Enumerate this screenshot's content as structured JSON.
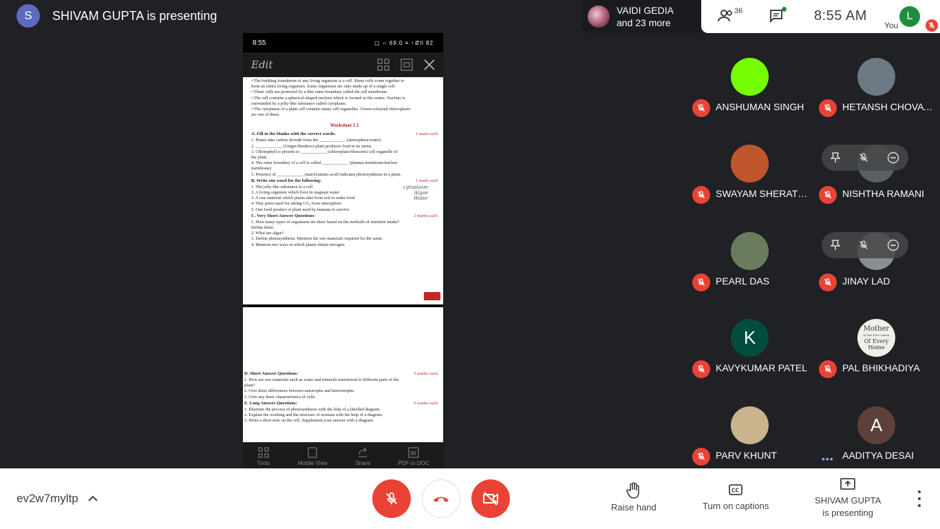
{
  "header": {
    "presenter_initial": "S",
    "presenter_text": "SHIVAM GUPTA is presenting"
  },
  "top_people": {
    "name": "VAIDI GEDIA",
    "more": "and 23 more"
  },
  "top_bar": {
    "people_count": "36",
    "time": "8:55  AM",
    "you_initial": "L",
    "you_label": "You"
  },
  "shared_screen": {
    "status_time": "8:55",
    "status_right": "▢ ∩ 69.0 ≡ ↑⇵ll 82",
    "edit_label": "Edit",
    "intro_lines": [
      "•  The building foundation of any living organism is a cell. Many cells come together to",
      "    form an entire living organism. Some organisms are only made up of a single cell.",
      "•  These cells are protected by a thin outer boundary called the cell membrane.",
      "•  The cell contains a spherical-shaped nucleus which is located in the centre. Nucleus is",
      "    surrounded by a jelly-like substance called cytoplasm.",
      "•  The cytoplasm of a plant cell contains many cell organelles. Green-coloured chloroplasts",
      "    are one of them."
    ],
    "worksheet_title": "Worksheet  1.1",
    "section_a": "A.  Fill in the blanks with the correct words:",
    "section_a_marks": "1 mark each",
    "section_a_items": [
      "1.  Plants take carbon dioxide from the ____________ (atmosphere/water)",
      "2.  ____________ (Ginger/Bamboo) plant produces food in its stems.",
      "3.  Chlorophyll is present in ____________ (chloroplast/ribosome) cell organelle of",
      "     the plant.",
      "4.  The outer boundary of a cell is called ____________ (plasma membrane/nuclear",
      "     membrane)",
      "5.  Presence of ____________ (starch/amino acid) indicates photosynthesis in a plant."
    ],
    "section_b": "B.  Write one word for the following:",
    "section_b_marks": "1 mark each",
    "section_b_items": [
      "1.  The jelly-like substance in a cell",
      "2.  A living organism which lives in stagnant water",
      "3.  A raw material which plants take from soil to make food",
      "4.  Tiny pores used for taking CO₂ from atmosphere",
      "5.  One food product of plant used by humans to survive"
    ],
    "section_b_answers": [
      "cytoplasm",
      "Algae",
      "Water",
      "",
      ""
    ],
    "section_c": "C.  Very Short Answer Questions:",
    "section_c_marks": "2 marks each",
    "section_c_items": [
      "1.  How many types of organisms are there based on the methods of nutrition intake?",
      "     Define them.",
      "2.  What are algae?",
      "3.  Define photosynthesis. Mention the raw materials required for the same.",
      "4.  Mention two ways in which plants obtain nitrogen."
    ],
    "section_d": "D.  Short Answer Questions:",
    "section_d_marks": "3 marks each",
    "section_d_items": [
      "1.  How are raw materials such as water and minerals transferred to different parts of the",
      "     plant?",
      "2.  Give three differences between autotrophs and heterotrophs.",
      "3.  Give any three characteristics of cells."
    ],
    "section_e": "E.  Long Answer Questions:",
    "section_e_marks": "5 marks each",
    "section_e_items": [
      "1.  Illustrate the process of photosynthesis with the help of a labelled diagram.",
      "2.  Explain the working and the structure of stomata with the help of a diagram.",
      "3.  Write a short note on the cell. Supplement your answer with a diagram."
    ],
    "nav": [
      "Tools",
      "Mobile View",
      "Share",
      "PDF to DOC"
    ]
  },
  "participants": [
    {
      "name": "ANSHUMAN SINGH",
      "avatar_color": "#76ff03",
      "initial": ""
    },
    {
      "name": "HETANSH CHOVAT...",
      "avatar_color": "#6d7a86",
      "initial": ""
    },
    {
      "name": "SWAYAM SHERATH...",
      "avatar_color": "#c0562c",
      "initial": ""
    },
    {
      "name": "NISHTHA RAMANI",
      "avatar_color": "#5a5f66",
      "initial": ""
    },
    {
      "name": "PEARL DAS",
      "avatar_color": "#6b7b5e",
      "initial": ""
    },
    {
      "name": "JINAY LAD",
      "avatar_color": "#8a8f94",
      "initial": ""
    },
    {
      "name": "KAVYKUMAR PATEL",
      "avatar_color": "#004d40",
      "initial": "K"
    },
    {
      "name": "PAL BHIKHADIYA",
      "avatar_color": "#f1efe9",
      "initial": ""
    },
    {
      "name": "PARV KHUNT",
      "avatar_color": "#c9b48e",
      "initial": ""
    },
    {
      "name": "AADITYA DESAI",
      "avatar_color": "#5d4037",
      "initial": "A"
    }
  ],
  "pal_avatar_text": [
    "Mother",
    "Is The True Queen",
    "Of Every Home"
  ],
  "bottom_bar": {
    "meeting_code": "ev2w7myltp",
    "raise_hand": "Raise hand",
    "captions": "Turn on captions",
    "presenting_line1": "SHIVAM GUPTA",
    "presenting_line2": "is presenting"
  },
  "colors": {
    "accent_red": "#ea4335",
    "you_avatar": "#1e8e3e",
    "presenter_avatar": "#5c6bc0"
  }
}
